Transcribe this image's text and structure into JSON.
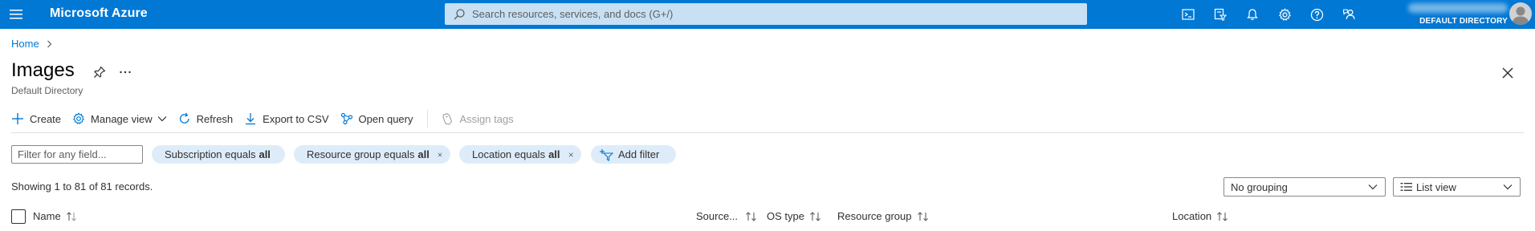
{
  "topbar": {
    "brand": "Microsoft Azure",
    "search_placeholder": "Search resources, services, and docs (G+/)",
    "icons": [
      "cloud-shell-icon",
      "directory-filter-icon",
      "notifications-icon",
      "settings-icon",
      "help-icon",
      "feedback-icon"
    ],
    "account_directory": "DEFAULT DIRECTORY"
  },
  "breadcrumb": {
    "home": "Home"
  },
  "page": {
    "title": "Images",
    "subtitle": "Default Directory"
  },
  "commands": {
    "create": "Create",
    "manage_view": "Manage view",
    "refresh": "Refresh",
    "export_csv": "Export to CSV",
    "open_query": "Open query",
    "assign_tags": "Assign tags"
  },
  "filters": {
    "placeholder": "Filter for any field...",
    "subscription": {
      "label": "Subscription equals",
      "value": "all"
    },
    "resource_group": {
      "label": "Resource group equals",
      "value": "all"
    },
    "location": {
      "label": "Location equals",
      "value": "all"
    },
    "add_filter": "Add filter"
  },
  "records_text": "Showing 1 to 81 of 81 records.",
  "grouping": {
    "selected": "No grouping"
  },
  "view": {
    "selected": "List view"
  },
  "table": {
    "columns": {
      "name": "Name",
      "source": "Source...",
      "os_type": "OS type",
      "resource_group": "Resource group",
      "location": "Location"
    }
  },
  "colors": {
    "accent": "#0078d4",
    "search_bg": "#c7e0f4",
    "pill_bg": "#deecf9"
  }
}
